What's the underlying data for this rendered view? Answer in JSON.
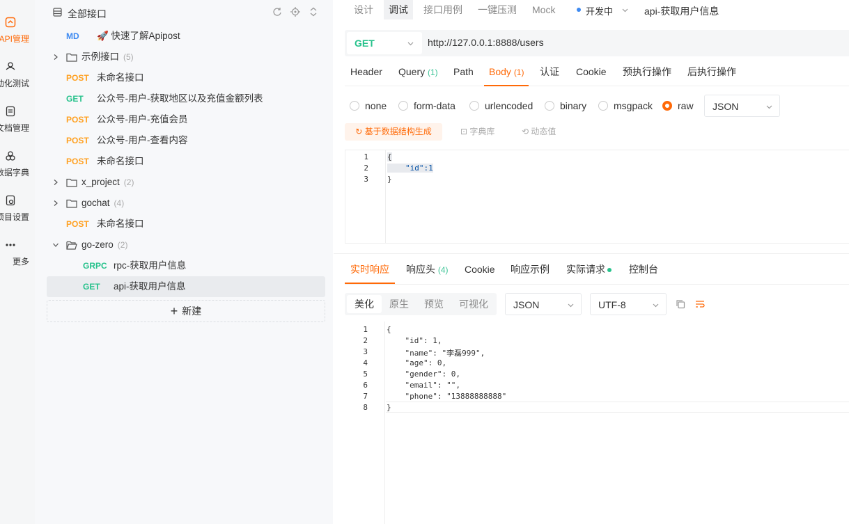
{
  "sidebar_rail": {
    "items": [
      {
        "label": "API管理",
        "active": true,
        "icon": "api-icon"
      },
      {
        "label": "自动化测试",
        "active": false,
        "icon": "automation-icon"
      },
      {
        "label": "文档管理",
        "active": false,
        "icon": "document-icon"
      },
      {
        "label": "数据字典",
        "active": false,
        "icon": "dictionary-icon"
      },
      {
        "label": "项目设置",
        "active": false,
        "icon": "settings-icon"
      },
      {
        "label": "更多",
        "active": false,
        "icon": "more-icon"
      }
    ]
  },
  "tree": {
    "title": "全部接口",
    "rows": [
      {
        "method": "MD",
        "label": "🚀 快速了解Apipost"
      },
      {
        "folder": true,
        "label": "示例接口",
        "count": "(5)"
      },
      {
        "method": "POST",
        "label": "未命名接口"
      },
      {
        "method": "GET",
        "label": "公众号-用户-获取地区以及充值金额列表"
      },
      {
        "method": "POST",
        "label": "公众号-用户-充值会员"
      },
      {
        "method": "POST",
        "label": "公众号-用户-查看内容"
      },
      {
        "method": "POST",
        "label": "未命名接口"
      },
      {
        "folder": true,
        "label": "x_project",
        "count": "(2)"
      },
      {
        "folder": true,
        "label": "gochat",
        "count": "(4)"
      },
      {
        "method": "POST",
        "label": "未命名接口"
      },
      {
        "folder": true,
        "open": true,
        "label": "go-zero",
        "count": "(2)"
      },
      {
        "method": "GRPC",
        "label": "rpc-获取用户信息",
        "indent": true
      },
      {
        "method": "GET",
        "label": "api-获取用户信息",
        "indent": true,
        "selected": true
      }
    ],
    "new_button": "新建"
  },
  "top_tabs": [
    "设计",
    "调试",
    "接口用例",
    "一键压测",
    "Mock"
  ],
  "top_tabs_active": "调试",
  "environment": "开发中",
  "current_api": "api-获取用户信息",
  "request": {
    "method": "GET",
    "url": "http://127.0.0.1:8888/users",
    "tabs": [
      {
        "label": "Header",
        "count": ""
      },
      {
        "label": "Query",
        "count": "(1)"
      },
      {
        "label": "Path",
        "count": ""
      },
      {
        "label": "Body",
        "count": "(1)"
      },
      {
        "label": "认证",
        "count": ""
      },
      {
        "label": "Cookie",
        "count": ""
      },
      {
        "label": "预执行操作",
        "count": ""
      },
      {
        "label": "后执行操作",
        "count": ""
      }
    ],
    "active_tab": "Body",
    "body_modes": [
      "none",
      "form-data",
      "urlencoded",
      "binary",
      "msgpack",
      "raw"
    ],
    "body_mode_selected": "raw",
    "raw_format": "JSON",
    "generate_button": "基于数据结构生成",
    "dict_button": "字典库",
    "dynamic_button": "动态值",
    "body_lines": [
      "1",
      "2",
      "3"
    ],
    "body_code": [
      "{",
      "\"id\":1",
      "}"
    ]
  },
  "response": {
    "tabs": [
      {
        "label": "实时响应",
        "count": ""
      },
      {
        "label": "响应头",
        "count": "(4)"
      },
      {
        "label": "Cookie",
        "count": ""
      },
      {
        "label": "响应示例",
        "count": ""
      },
      {
        "label": "实际请求",
        "count": ""
      },
      {
        "label": "控制台",
        "count": ""
      }
    ],
    "active_tab": "实时响应",
    "format_tabs": [
      "美化",
      "原生",
      "预览",
      "可视化"
    ],
    "format_active": "美化",
    "format_select": "JSON",
    "encoding_select": "UTF-8",
    "lines": [
      "1",
      "2",
      "3",
      "4",
      "5",
      "6",
      "7",
      "8"
    ],
    "code": [
      "{",
      "    \"id\": 1,",
      "    \"name\": \"李磊999\",",
      "    \"age\": 0,",
      "    \"gender\": 0,",
      "    \"email\": \"\",",
      "    \"phone\": \"13888888888\"",
      "}"
    ]
  },
  "colors": {
    "accent": "#ff6907",
    "post": "#ffa122",
    "get": "#27c28c",
    "md": "#3e8af1"
  }
}
